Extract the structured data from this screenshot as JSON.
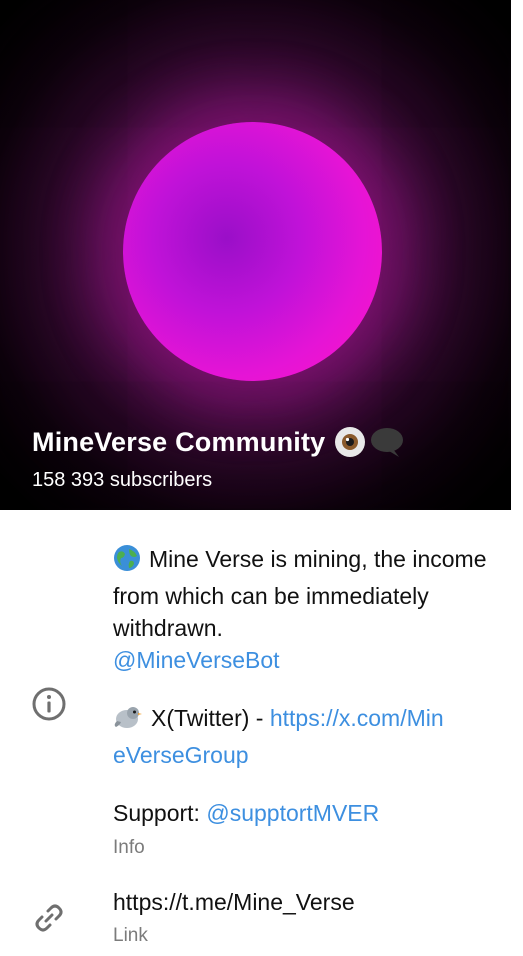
{
  "channel": {
    "name": "MineVerse Community",
    "subscribers": "158 393 subscribers"
  },
  "about": {
    "line1_text": "Mine Verse is mining, the income from which can be immediately withdrawn.",
    "bot_handle": "@MineVerseBot",
    "twitter_prefix": "X(Twitter) - ",
    "twitter_url_part1": "https://x.com/Min",
    "twitter_url_part2": "eVerseGroup",
    "support_label": "Support: ",
    "support_handle": "@supptortMVER",
    "caption": "Info"
  },
  "link_section": {
    "url": "https://t.me/Mine_Verse",
    "caption": "Link"
  },
  "icons": {
    "title_emojis": [
      "eye-emoji",
      "speech-bubble-emoji"
    ],
    "about": "globe-emoji",
    "twitter": "bird-emoji",
    "info": "info-icon",
    "link": "link-icon"
  },
  "colors": {
    "link": "#3d8fe0",
    "caption": "#7b7b7b",
    "orb": "#e514d6"
  }
}
